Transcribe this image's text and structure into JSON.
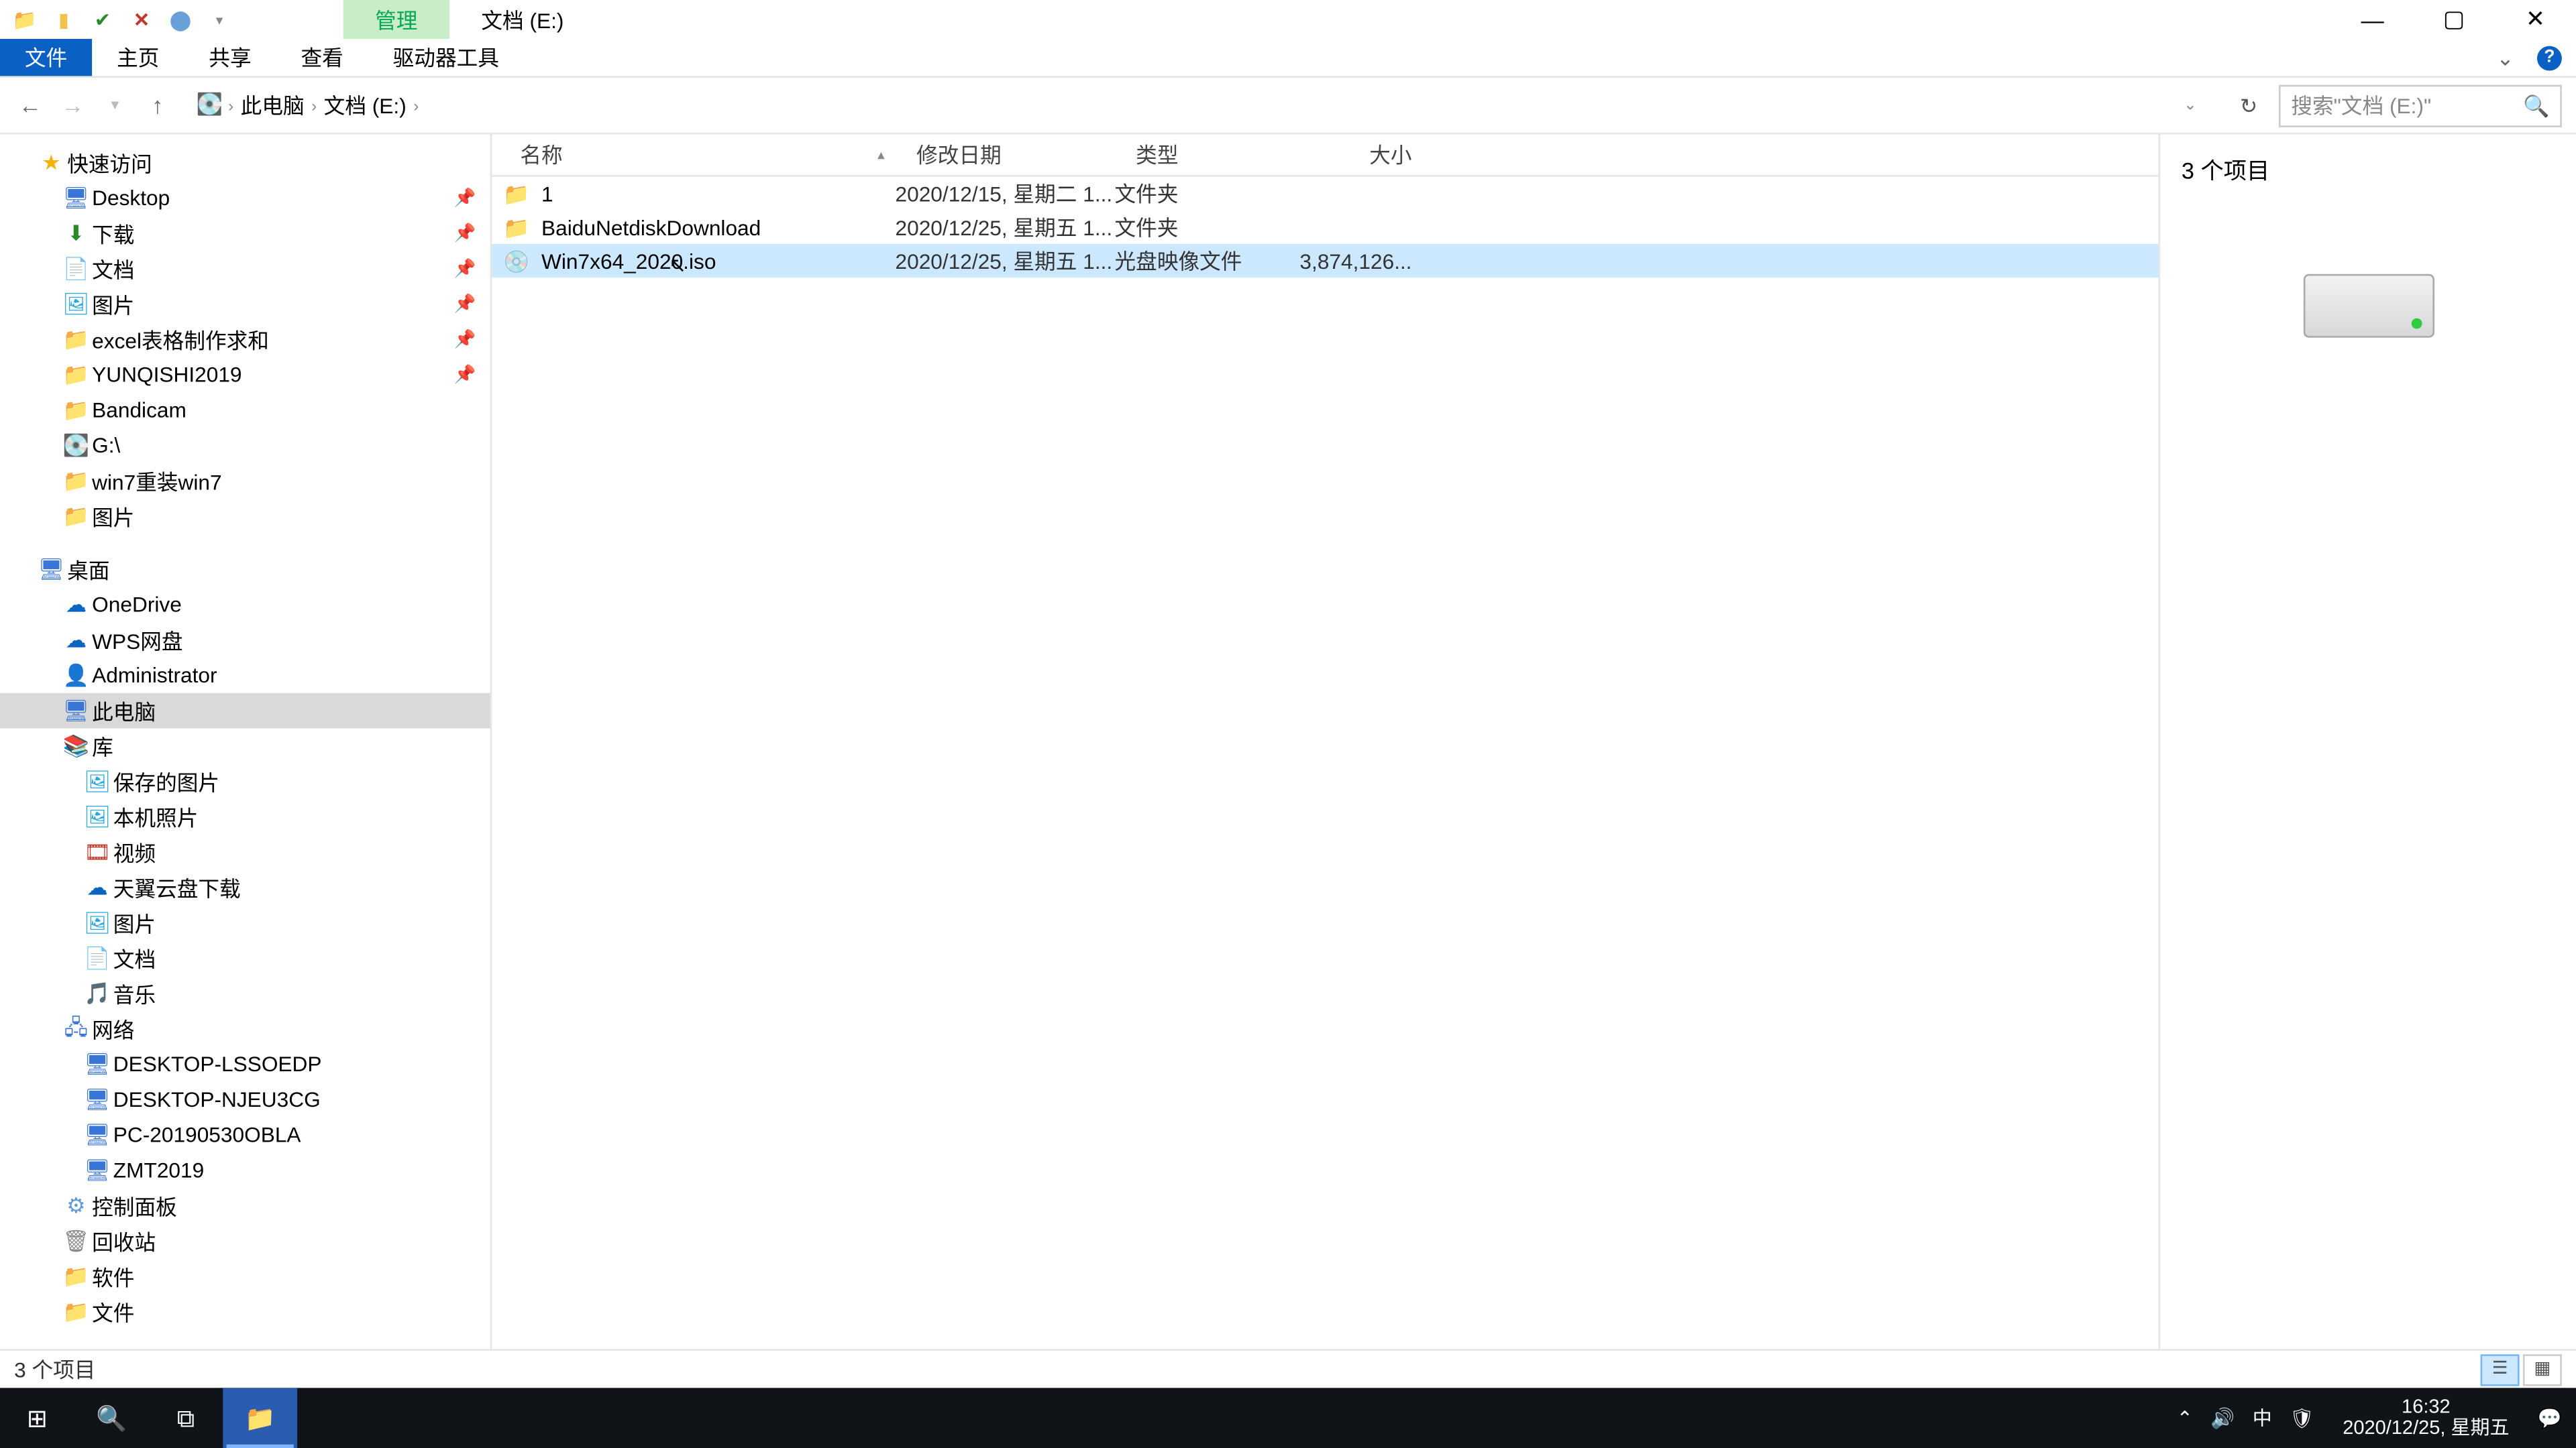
{
  "titlebar": {
    "contextual_tab": "管理",
    "path_tab": "文档 (E:)"
  },
  "ribbon": {
    "file": "文件",
    "home": "主页",
    "share": "共享",
    "view": "查看",
    "drive_tools": "驱动器工具"
  },
  "breadcrumb": {
    "seg1": "此电脑",
    "seg2": "文档 (E:)"
  },
  "search": {
    "placeholder": "搜索\"文档 (E:)\""
  },
  "tree": {
    "quick_access": "快速访问",
    "desktop": "Desktop",
    "downloads": "下载",
    "documents": "文档",
    "pictures": "图片",
    "excel": "excel表格制作求和",
    "yunqishi": "YUNQISHI2019",
    "bandicam": "Bandicam",
    "gdrive": "G:\\",
    "win7": "win7重装win7",
    "pictures2": "图片",
    "desktop2": "桌面",
    "onedrive": "OneDrive",
    "wps": "WPS网盘",
    "admin": "Administrator",
    "thispc": "此电脑",
    "libraries": "库",
    "saved_pics": "保存的图片",
    "camera_roll": "本机照片",
    "videos": "视频",
    "tianyi": "天翼云盘下载",
    "lib_pics": "图片",
    "lib_docs": "文档",
    "music": "音乐",
    "network": "网络",
    "pc_lss": "DESKTOP-LSSOEDP",
    "pc_nje": "DESKTOP-NJEU3CG",
    "pc_obla": "PC-20190530OBLA",
    "pc_zmt": "ZMT2019",
    "control_panel": "控制面板",
    "recycle": "回收站",
    "soft": "软件",
    "files": "文件"
  },
  "columns": {
    "name": "名称",
    "date": "修改日期",
    "type": "类型",
    "size": "大小"
  },
  "rows": [
    {
      "icon": "folder",
      "name": "1",
      "date": "2020/12/15, 星期二 1...",
      "type": "文件夹",
      "size": "",
      "selected": false
    },
    {
      "icon": "folder",
      "name": "BaiduNetdiskDownload",
      "date": "2020/12/25, 星期五 1...",
      "type": "文件夹",
      "size": "",
      "selected": false
    },
    {
      "icon": "disc",
      "name": "Win7x64_2020.iso",
      "date": "2020/12/25, 星期五 1...",
      "type": "光盘映像文件",
      "size": "3,874,126...",
      "selected": true
    }
  ],
  "details": {
    "title": "3 个项目"
  },
  "status": {
    "text": "3 个项目"
  },
  "taskbar": {
    "time": "16:32",
    "date": "2020/12/25, 星期五",
    "ime": "中"
  }
}
